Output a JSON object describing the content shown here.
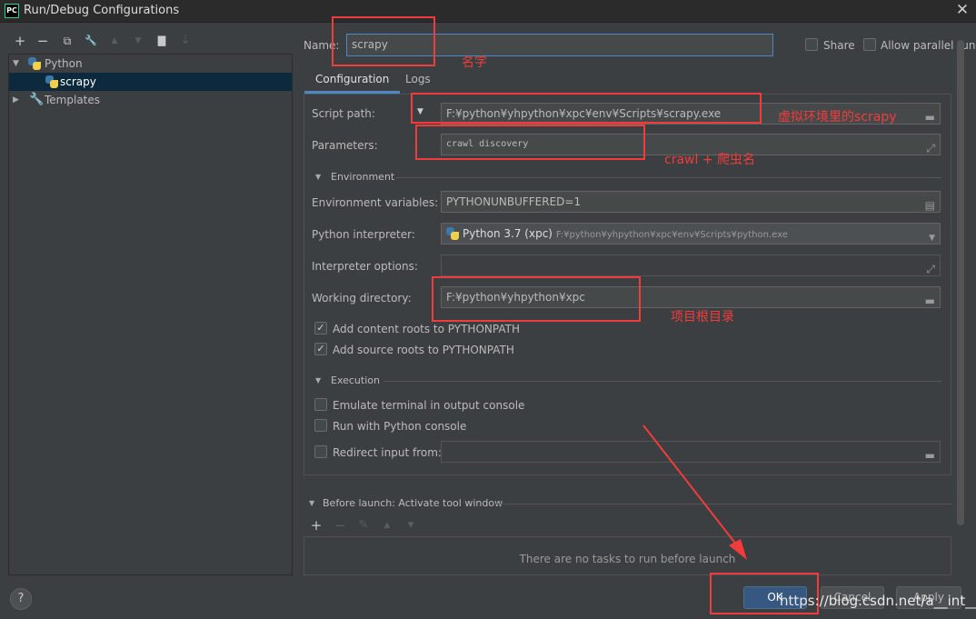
{
  "window": {
    "app_icon_text": "PC",
    "title": "Run/Debug Configurations",
    "close_glyph": "✕"
  },
  "toolbar": {
    "add": "+",
    "remove": "−",
    "copy": "⧉",
    "edit": "🔧",
    "up": "▲",
    "down": "▼",
    "folder": "▇",
    "sort": "⇣"
  },
  "tree": {
    "python_label": "Python",
    "scrapy_label": "scrapy",
    "templates_label": "Templates"
  },
  "name": {
    "label": "Name:",
    "value": "scrapy",
    "share_label": "Share",
    "parallel_label": "Allow parallel run"
  },
  "tabs": [
    {
      "label": "Configuration"
    },
    {
      "label": "Logs"
    }
  ],
  "config": {
    "script_path_label": "Script path:",
    "script_path_value": "F:¥python¥yhpython¥xpc¥env¥Scripts¥scrapy.exe",
    "parameters_label": "Parameters:",
    "parameters_value": "crawl discovery",
    "environment_header": "Environment",
    "env_vars_label": "Environment variables:",
    "env_vars_value": "PYTHONUNBUFFERED=1",
    "interpreter_label": "Python interpreter:",
    "interpreter_name": "Python 3.7 (xpc)",
    "interpreter_path": "F:¥python¥yhpython¥xpc¥env¥Scripts¥python.exe",
    "interpreter_options_label": "Interpreter options:",
    "working_dir_label": "Working directory:",
    "working_dir_value": "F:¥python¥yhpython¥xpc",
    "content_roots_label": "Add content roots to PYTHONPATH",
    "source_roots_label": "Add source roots to PYTHONPATH",
    "execution_header": "Execution",
    "emulate_terminal_label": "Emulate terminal in output console",
    "python_console_label": "Run with Python console",
    "redirect_input_label": "Redirect input from:"
  },
  "before_launch": {
    "header": "Before launch: Activate tool window",
    "add": "+",
    "remove": "−",
    "edit": "✎",
    "up": "▲",
    "down": "▼",
    "empty_text": "There are no tasks to run before launch"
  },
  "buttons": {
    "ok": "OK",
    "cancel": "Cancel",
    "apply": "Apply",
    "help": "?"
  },
  "annotations": {
    "name_note": "名字",
    "script_note": "虚拟环境里的scrapy",
    "params_note": "crawl + 爬虫名",
    "workdir_note": "项目根目录",
    "watermark": "https://blog.csdn.net/a__int__"
  },
  "colors": {
    "annotation": "#f23c3c",
    "accent": "#4a88c7",
    "selection": "#0d293e",
    "primary_button": "#365880"
  }
}
